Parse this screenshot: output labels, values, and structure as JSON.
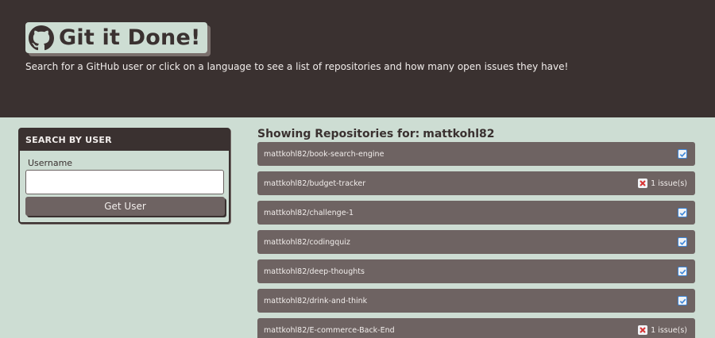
{
  "header": {
    "title": "Git it Done!",
    "subtitle": "Search for a GitHub user or click on a language to see a list of repositories and how many open issues they have!"
  },
  "search": {
    "heading": "SEARCH BY USER",
    "label": "Username",
    "input_value": "",
    "button": "Get User"
  },
  "results": {
    "heading": "Showing Repositories for:",
    "user": "mattkohl82",
    "repos": [
      {
        "name": "mattkohl82/book-search-engine",
        "issues": ""
      },
      {
        "name": "mattkohl82/budget-tracker",
        "issues": "1 issue(s)"
      },
      {
        "name": "mattkohl82/challenge-1",
        "issues": ""
      },
      {
        "name": "mattkohl82/codingquiz",
        "issues": ""
      },
      {
        "name": "mattkohl82/deep-thoughts",
        "issues": ""
      },
      {
        "name": "mattkohl82/drink-and-think",
        "issues": ""
      },
      {
        "name": "mattkohl82/E-commerce-Back-End",
        "issues": "1 issue(s)"
      }
    ]
  },
  "icons": {
    "logo": "github-octocat-icon",
    "ok": "checkbox-check-icon",
    "issue": "red-x-icon"
  },
  "colors": {
    "dark": "#3a3130",
    "light": "#cdddd3",
    "item": "#6e6362",
    "check": "#3c86d9",
    "x": "#d83333"
  }
}
